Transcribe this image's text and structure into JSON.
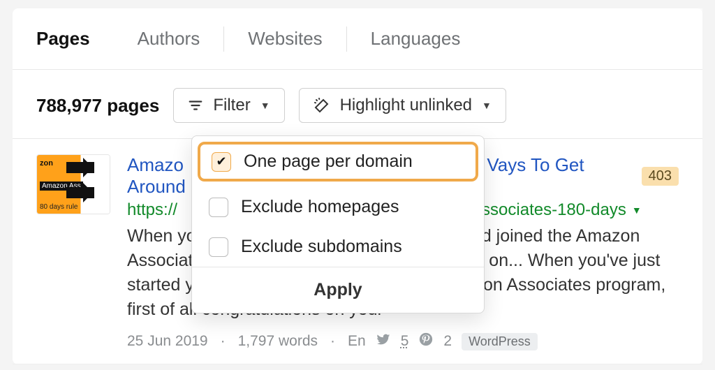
{
  "tabs": {
    "pages": "Pages",
    "authors": "Authors",
    "websites": "Websites",
    "languages": "Languages"
  },
  "toolbar": {
    "count_text": "788,977 pages",
    "filter_label": "Filter",
    "highlight_label": "Highlight unlinked"
  },
  "filter_dropdown": {
    "one_per_domain": "One page per domain",
    "exclude_homepages": "Exclude homepages",
    "exclude_subdomains": "Exclude subdomains",
    "apply": "Apply"
  },
  "result": {
    "title_left": "Amazo",
    "title_right": "Vays To Get Around …",
    "badge": "403",
    "url_left": "https://",
    "url_right": "ssociates-180-days",
    "snippet": "When you've just started your own website and joined the Amazon Associates program, first of all congratulations on... When you've just started your own website and joined the Amazon Associates program, first of all congratulations on your",
    "date": "25 Jun 2019",
    "words": "1,797 words",
    "lang": "En",
    "twitter_count": "5",
    "pinterest_count": "2",
    "platform": "WordPress",
    "thumb": {
      "t1": "zon",
      "t2": "Amazon Ass",
      "t3": "80 days rule"
    }
  }
}
